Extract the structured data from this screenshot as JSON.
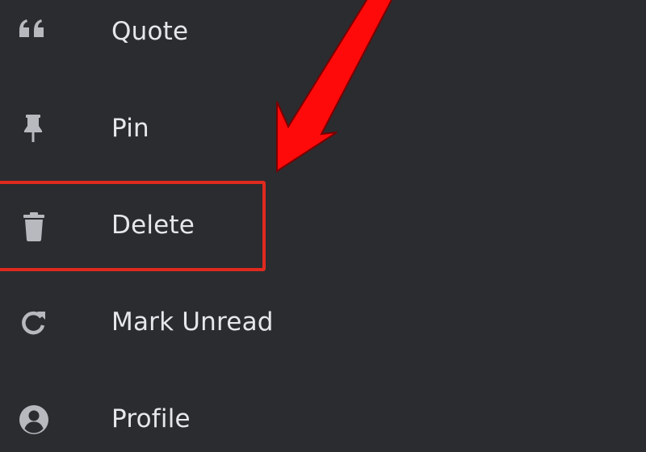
{
  "menu": {
    "items": [
      {
        "id": "quote",
        "label": "Quote",
        "icon": "quote-icon"
      },
      {
        "id": "pin",
        "label": "Pin",
        "icon": "pin-icon"
      },
      {
        "id": "delete",
        "label": "Delete",
        "icon": "trash-icon"
      },
      {
        "id": "mark-unread",
        "label": "Mark Unread",
        "icon": "refresh-icon"
      },
      {
        "id": "profile",
        "label": "Profile",
        "icon": "profile-icon"
      }
    ]
  },
  "annotation": {
    "highlighted_item": "delete",
    "highlight_color": "#e02a1f",
    "arrow_color": "#ff0a0a"
  },
  "colors": {
    "background": "#2b2c30",
    "text": "#e6e7ea",
    "icon": "#b7b9bf"
  }
}
